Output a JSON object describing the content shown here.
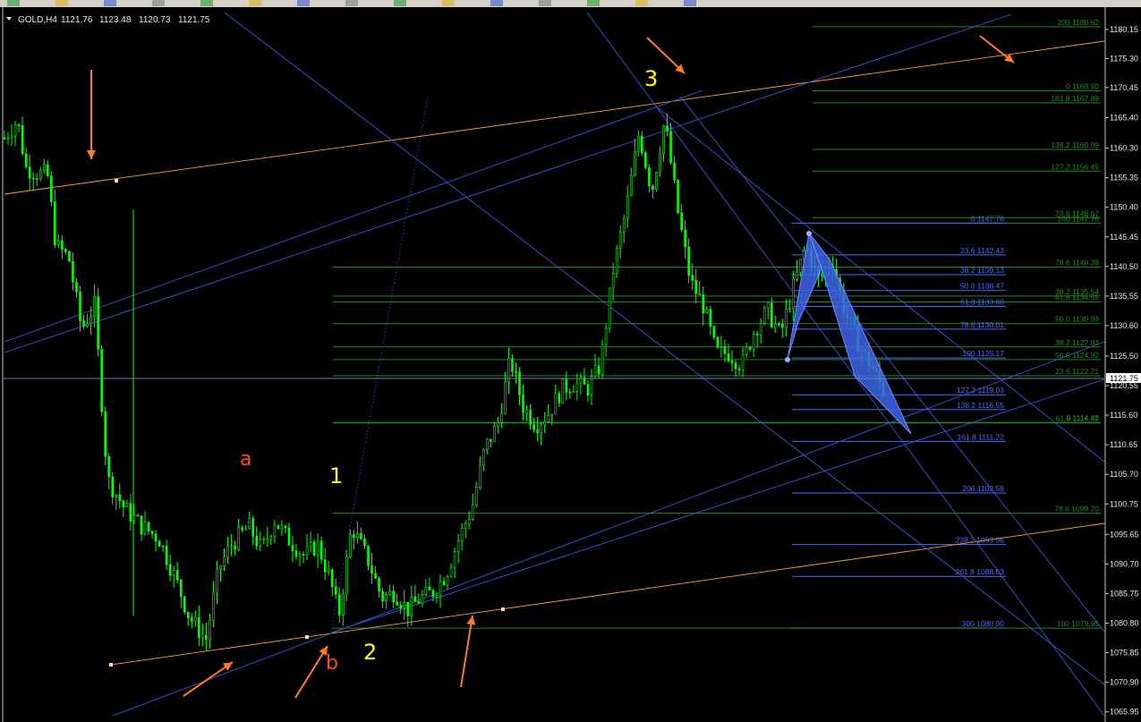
{
  "toolbar": {
    "icons": [
      "new-order-icon",
      "star-icon",
      "zoom-in-icon",
      "zoom-out-icon",
      "tile-icon",
      "autoscroll-icon",
      "chart-shift-icon",
      "add-indicator-icon",
      "period-icon",
      "template-icon",
      "cursor-icon",
      "crosshair-icon",
      "text-icon",
      "arrow-icon",
      "timeframe-icon"
    ]
  },
  "header": {
    "symbol": "GOLD,H4",
    "open": "1121.76",
    "high": "1123.48",
    "low": "1120.73",
    "close": "1121.75"
  },
  "colors": {
    "background": "#000000",
    "candle": "#00ff00",
    "trend_blue": "#3b55e0",
    "trend_orange": "#ff9c3a",
    "fib_green": "#1f8a1f",
    "fib_blue": "#4a6bff",
    "arrow": "#ff7a2a",
    "wave_yellow": "#ffff00",
    "wave_orange": "#ff4a1a",
    "pattern_fill": "#3f64e8"
  },
  "chart_data": {
    "type": "candlestick",
    "instrument": "GOLD",
    "timeframe": "H4",
    "ylim": [
      1065.95,
      1183.0
    ],
    "y_ticks": [
      "1180.15",
      "1175.30",
      "1170.45",
      "1165.40",
      "1160.30",
      "1155.35",
      "1150.40",
      "1145.45",
      "1140.50",
      "1135.55",
      "1130.60",
      "1125.50",
      "1120.55",
      "1115.60",
      "1110.65",
      "1105.70",
      "1100.75",
      "1095.65",
      "1090.70",
      "1085.75",
      "1080.80",
      "1075.85",
      "1070.90",
      "1065.95"
    ],
    "current_price": "1121.75",
    "price_path": [
      [
        0,
        1162
      ],
      [
        0.03,
        1165
      ],
      [
        0.05,
        1157
      ],
      [
        0.08,
        1156
      ],
      [
        0.1,
        1156
      ],
      [
        0.12,
        1144
      ],
      [
        0.15,
        1142
      ],
      [
        0.18,
        1130
      ],
      [
        0.21,
        1134
      ],
      [
        0.24,
        1105
      ],
      [
        0.28,
        1100
      ],
      [
        0.32,
        1097
      ],
      [
        0.36,
        1095
      ],
      [
        0.4,
        1088
      ],
      [
        0.43,
        1082
      ],
      [
        0.47,
        1078
      ],
      [
        0.5,
        1090
      ],
      [
        0.53,
        1094
      ],
      [
        0.57,
        1097
      ],
      [
        0.6,
        1093
      ],
      [
        0.63,
        1098
      ],
      [
        0.66,
        1095
      ],
      [
        0.7,
        1092
      ],
      [
        0.73,
        1094
      ],
      [
        0.76,
        1088
      ],
      [
        0.78,
        1082
      ],
      [
        0.81,
        1097
      ],
      [
        0.85,
        1091
      ],
      [
        0.88,
        1085
      ],
      [
        0.91,
        1086
      ],
      [
        0.94,
        1083
      ],
      [
        0.97,
        1085
      ],
      [
        1.0,
        1086
      ],
      [
        1.03,
        1089
      ],
      [
        1.06,
        1095
      ],
      [
        1.09,
        1100
      ],
      [
        1.12,
        1110
      ],
      [
        1.15,
        1114
      ],
      [
        1.18,
        1125
      ],
      [
        1.21,
        1117
      ],
      [
        1.24,
        1114
      ],
      [
        1.27,
        1116
      ],
      [
        1.3,
        1120
      ],
      [
        1.33,
        1121
      ],
      [
        1.36,
        1120
      ],
      [
        1.39,
        1124
      ],
      [
        1.42,
        1140
      ],
      [
        1.45,
        1150
      ],
      [
        1.48,
        1163
      ],
      [
        1.51,
        1153
      ],
      [
        1.54,
        1165
      ],
      [
        1.57,
        1150
      ],
      [
        1.6,
        1138
      ],
      [
        1.63,
        1134
      ],
      [
        1.66,
        1126
      ],
      [
        1.69,
        1126
      ],
      [
        1.72,
        1124
      ],
      [
        1.75,
        1130
      ],
      [
        1.78,
        1133
      ],
      [
        1.81,
        1129
      ],
      [
        1.84,
        1137
      ],
      [
        1.87,
        1144
      ],
      [
        1.9,
        1138
      ],
      [
        1.93,
        1142
      ],
      [
        1.96,
        1133
      ],
      [
        1.99,
        1128
      ],
      [
        2.02,
        1124
      ],
      [
        2.05,
        1120
      ]
    ],
    "fib_levels": [
      {
        "label": "200 1180.62",
        "price": 1180.62,
        "color": "green"
      },
      {
        "label": "0 1169.90",
        "price": 1169.9,
        "color": "green"
      },
      {
        "label": "161.8 1167.89",
        "price": 1167.89,
        "color": "green"
      },
      {
        "label": "138.2 1160.09",
        "price": 1160.09,
        "color": "green"
      },
      {
        "label": "127.2 1156.45",
        "price": 1156.45,
        "color": "green"
      },
      {
        "label": "100 1147.76",
        "price": 1147.76,
        "color": "green"
      },
      {
        "label": "0 1147.76",
        "price": 1147.76,
        "color": "blue"
      },
      {
        "label": "23.6 1148.67",
        "price": 1148.67,
        "color": "green"
      },
      {
        "label": "23.6 1142.43",
        "price": 1142.43,
        "color": "blue"
      },
      {
        "label": "78.6 1140.39",
        "price": 1140.39,
        "color": "green"
      },
      {
        "label": "38.2 1139.13",
        "price": 1139.13,
        "color": "blue"
      },
      {
        "label": "50.0 1136.47",
        "price": 1136.47,
        "color": "blue"
      },
      {
        "label": "61.8 1134.55",
        "price": 1134.55,
        "color": "green"
      },
      {
        "label": "38.2 1135.54",
        "price": 1135.54,
        "color": "green"
      },
      {
        "label": "61.8 1133.80",
        "price": 1133.8,
        "color": "blue"
      },
      {
        "label": "50.0 1130.93",
        "price": 1130.93,
        "color": "green"
      },
      {
        "label": "78.6 1130.01",
        "price": 1130.01,
        "color": "blue"
      },
      {
        "label": "38.2 1127.03",
        "price": 1127.03,
        "color": "green"
      },
      {
        "label": "100 1125.17",
        "price": 1125.17,
        "color": "blue"
      },
      {
        "label": "50.0 1124.92",
        "price": 1124.92,
        "color": "green"
      },
      {
        "label": "23.6 1122.21",
        "price": 1122.21,
        "color": "green"
      },
      {
        "label": "127.2 1119.03",
        "price": 1119.03,
        "color": "blue"
      },
      {
        "label": "138.2 1116.55",
        "price": 1116.55,
        "color": "blue"
      },
      {
        "label": "0 1114.40",
        "price": 1114.4,
        "color": "green"
      },
      {
        "label": "61.8 1114.31",
        "price": 1114.31,
        "color": "green"
      },
      {
        "label": "161.8 1111.22",
        "price": 1111.22,
        "color": "blue"
      },
      {
        "label": "200 1102.59",
        "price": 1102.59,
        "color": "blue"
      },
      {
        "label": "78.6 1099.20",
        "price": 1099.2,
        "color": "green"
      },
      {
        "label": "238.2 1093.96",
        "price": 1093.96,
        "color": "blue"
      },
      {
        "label": "261.8 1088.63",
        "price": 1088.63,
        "color": "blue"
      },
      {
        "label": "300 1080.00",
        "price": 1080.0,
        "color": "blue"
      },
      {
        "label": "100 1079.95",
        "price": 1079.95,
        "color": "green"
      }
    ],
    "wave_labels": [
      {
        "text": "1",
        "color": "yellow"
      },
      {
        "text": "2",
        "color": "yellow"
      },
      {
        "text": "3",
        "color": "yellow"
      },
      {
        "text": "a",
        "color": "orange"
      },
      {
        "text": "b",
        "color": "orange"
      }
    ],
    "annotations": [
      "orange arrows pointing to trendline touches",
      "blue harmonic pattern near recent highs"
    ]
  }
}
